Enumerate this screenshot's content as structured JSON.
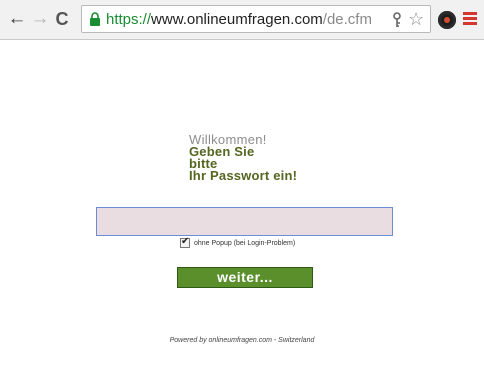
{
  "browser": {
    "url_scheme": "https://",
    "url_host": "www.onlineumfragen.com",
    "url_path": "/de.cfm",
    "back_icon": "←",
    "forward_icon": "→",
    "reload_icon": "C",
    "star_icon": "☆"
  },
  "login": {
    "welcome": "Willkommen!",
    "prompt_lines": [
      "Geben Sie",
      "bitte",
      "Ihr Passwort ein!"
    ],
    "password_value": "",
    "checkbox_label": "ohne Popup (bei Login-Problem)",
    "submit_label": "weiter..."
  },
  "footer": {
    "text": "Powered by onlineumfragen.com - Switzerland"
  }
}
